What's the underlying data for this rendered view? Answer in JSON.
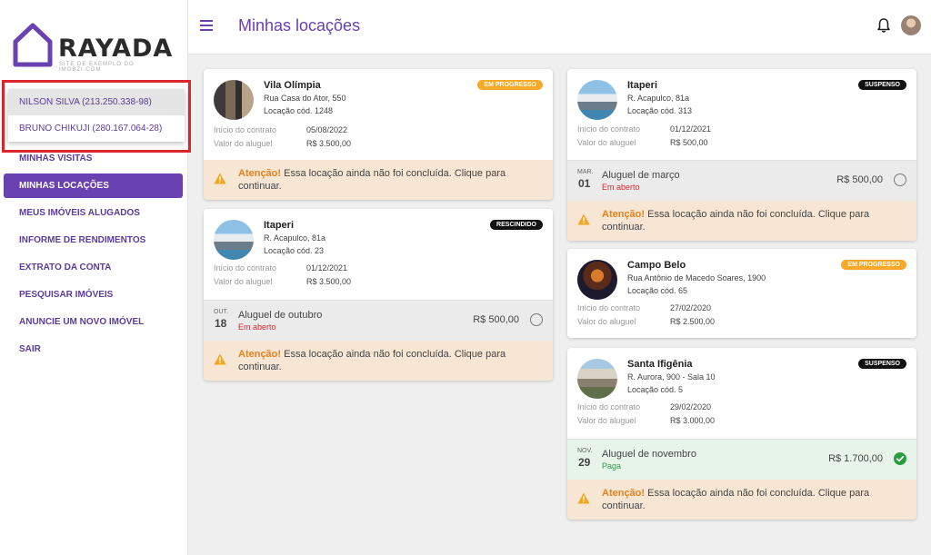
{
  "brand": {
    "name": "RAYADA",
    "tagline": "SITE DE EXEMPLO DO IMOBZI.COM",
    "color": "#6941b0"
  },
  "user_switcher": {
    "users": [
      {
        "label": "NILSON SILVA (213.250.338-98)"
      },
      {
        "label": "BRUNO CHIKUJI (280.167.064-28)"
      }
    ]
  },
  "nav": {
    "items": [
      {
        "label": "MINHAS VISITAS"
      },
      {
        "label": "MINHAS LOCAÇÕES"
      },
      {
        "label": "MEUS IMÓVEIS ALUGADOS"
      },
      {
        "label": "INFORME DE RENDIMENTOS"
      },
      {
        "label": "EXTRATO DA CONTA"
      },
      {
        "label": "PESQUISAR IMÓVEIS"
      },
      {
        "label": "ANUNCIE UM NOVO IMÓVEL"
      },
      {
        "label": "SAIR"
      }
    ]
  },
  "header": {
    "title": "Minhas locações"
  },
  "labels": {
    "contract_start": "Início do contrato",
    "rent_value": "Valor do aluguel",
    "warning_title": "Atenção!",
    "warning_text": " Essa locação ainda não foi concluída. Clique para continuar."
  },
  "cards": [
    {
      "name": "Vila Olímpia",
      "address": "Rua Casa do Ator, 550",
      "code": "Locação cód. 1248",
      "status": "EM PROGRESSO",
      "start": "05/08/2022",
      "rent": "R$ 3.500,00"
    },
    {
      "name": "Itaperi",
      "address": "R. Acapulco, 81a",
      "code": "Locação cód. 23",
      "status": "RESCINDIDO",
      "start": "01/12/2021",
      "rent": "R$ 3.500,00",
      "bill": {
        "month": "OUT.",
        "day": "18",
        "title": "Aluguel de outubro",
        "status": "Em aberto",
        "amount": "R$ 500,00"
      }
    },
    {
      "name": "Itaperi",
      "address": "R. Acapulco, 81a",
      "code": "Locação cód. 313",
      "status": "SUSPENSO",
      "start": "01/12/2021",
      "rent": "R$ 500,00",
      "bill": {
        "month": "MAR.",
        "day": "01",
        "title": "Aluguel de março",
        "status": "Em aberto",
        "amount": "R$ 500,00"
      }
    },
    {
      "name": "Campo Belo",
      "address": "Rua Antônio de Macedo Soares, 1900",
      "code": "Locação cód. 65",
      "status": "EM PROGRESSO",
      "start": "27/02/2020",
      "rent": "R$ 2.500,00"
    },
    {
      "name": "Santa Ifigênia",
      "address": "R. Aurora, 900 - Sala 10",
      "code": "Locação cód. 5",
      "status": "SUSPENSO",
      "start": "29/02/2020",
      "rent": "R$ 3.000,00",
      "bill": {
        "month": "NOV.",
        "day": "29",
        "title": "Aluguel de novembro",
        "status": "Paga",
        "amount": "R$ 1.700,00"
      }
    }
  ]
}
